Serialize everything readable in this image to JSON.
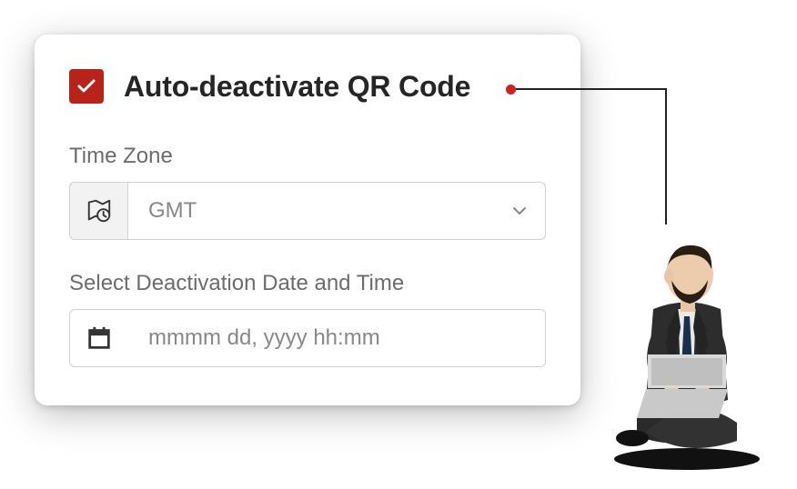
{
  "card": {
    "checkbox_checked": true,
    "title": "Auto-deactivate QR Code",
    "fields": {
      "timezone": {
        "label": "Time Zone",
        "value": "GMT",
        "icon": "timezone-icon"
      },
      "datetime": {
        "label": "Select Deactivation Date and Time",
        "placeholder": "mmmm dd, yyyy hh:mm",
        "icon": "calendar-icon"
      }
    }
  },
  "colors": {
    "accent": "#B7231A",
    "text_dark": "#252525",
    "text_muted": "#6c6c6c",
    "placeholder": "#888888"
  }
}
